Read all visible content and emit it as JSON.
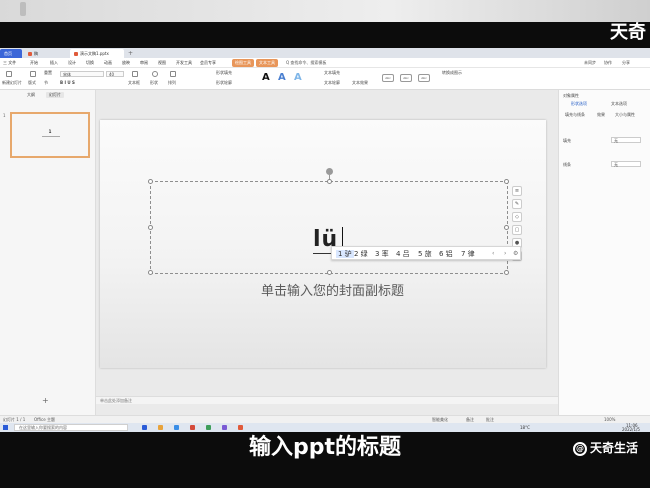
{
  "watermark_top": "天奇",
  "tabbar": {
    "home": "首页",
    "tab2": "稿壳",
    "file": "演示文稿1.pptx",
    "plus": "+"
  },
  "menu": {
    "items": [
      "三 文件",
      "开始",
      "插入",
      "设计",
      "切换",
      "动画",
      "放映",
      "审阅",
      "视图",
      "开发工具",
      "会员专享"
    ],
    "pill_left": "绘图工具",
    "pill_right": "文本工具",
    "pill_left_color": "#e8965a",
    "pill_right_color": "#e8965a",
    "find": "Q 查找命令、搜索模板",
    "right_items": [
      "未同步",
      "协作",
      "分享"
    ]
  },
  "ribbon": {
    "new_slide": "新建幻灯片",
    "layout": "版式",
    "reset": "重置",
    "section": "节",
    "font": "宋体",
    "size": "40",
    "text_box": "文本框",
    "shapes": "形状",
    "arrange": "排列",
    "style_labels": [
      "Abc",
      "Abc",
      "Abc"
    ],
    "fill": "形状填充",
    "outline": "形状轮廓",
    "text_fill": "文本填充",
    "text_outline": "文本轮廓",
    "text_effect": "文本效果",
    "convert_smart": "转换成图示"
  },
  "left_panel": {
    "tabs": [
      "大纲",
      "幻灯片"
    ],
    "slide_number": "1",
    "thumb_title": "1",
    "add_icon": "+"
  },
  "slide": {
    "ime_text": "lü",
    "subtitle_placeholder": "单击输入您的封面副标题"
  },
  "ime_candidates": {
    "items": [
      "1 驴",
      "2 绿",
      "3 率",
      "4 吕",
      "5 旅",
      "6 铝",
      "7 律"
    ],
    "prev": "‹",
    "next": "›",
    "settings": "⚙"
  },
  "notes": "单击此处添加备注",
  "right_panel": {
    "title": "对象属性",
    "tabs": [
      "形状选项",
      "文本选项"
    ],
    "sub_tabs": [
      "填充与线条",
      "效果",
      "大小与属性"
    ],
    "rows": [
      {
        "label": "填充",
        "value": "无"
      },
      {
        "label": "线条",
        "value": "无"
      }
    ]
  },
  "statusbar": {
    "slide_info": "幻灯片 1 / 1",
    "theme": "Office 主题",
    "smart": "智能美化",
    "notes": "备注",
    "comments": "批注",
    "zoom": "100%"
  },
  "taskbar": {
    "search": "在这里输入你要搜索的内容",
    "temp": "18°C",
    "time": "11:06",
    "date": "2022/1/5",
    "app_colors": [
      "#2a5bd7",
      "#e8a33c",
      "#3a8ee6",
      "#d44a3a",
      "#3f9e5a",
      "#7a5ad4",
      "#e05a3a"
    ]
  },
  "caption": "输入ppt的标题",
  "logo_bottom": "天奇生活",
  "logo_bottom_mark": "@"
}
